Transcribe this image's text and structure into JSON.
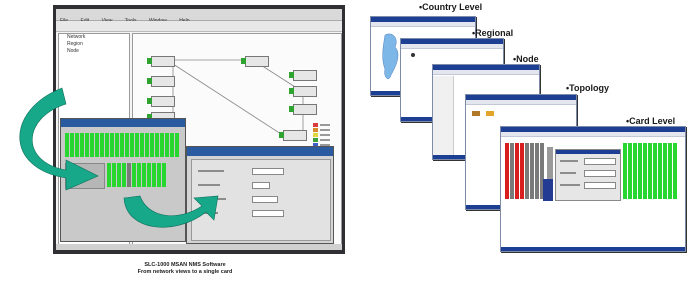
{
  "main_window": {
    "menu": [
      "File",
      "Edit",
      "View",
      "Tools",
      "Window",
      "Help"
    ],
    "tree_items": [
      "Network",
      "Region",
      "Node"
    ],
    "legend_colors": [
      "#d93b3b",
      "#d98a2b",
      "#e0d640",
      "#3ba03b",
      "#3b5fc4"
    ]
  },
  "caption": {
    "line1": "SLC-1000 MSAN NMS Software",
    "line2": "From network views to a single card"
  },
  "levels": [
    {
      "label": "•Country Level"
    },
    {
      "label": "•Regional"
    },
    {
      "label": "•Node"
    },
    {
      "label": "•Topology"
    },
    {
      "label": "•Card Level"
    }
  ],
  "colors": {
    "arrow": "#17a88a",
    "card_green": "#27d62f",
    "card_red": "#d81e1e",
    "titlebar": "#1c3f94"
  }
}
